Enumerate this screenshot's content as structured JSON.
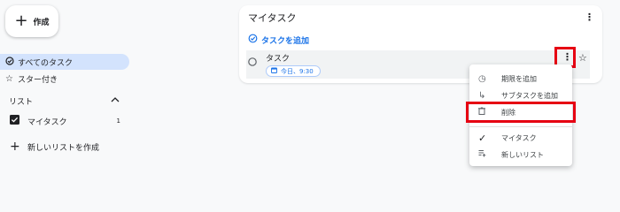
{
  "sidebar": {
    "create_label": "作成",
    "all_tasks_label": "すべてのタスク",
    "starred_label": "スター付き",
    "lists_header": "リスト",
    "list_item_label": "マイタスク",
    "list_item_count": "1",
    "new_list_label": "新しいリストを作成"
  },
  "main": {
    "list_title": "マイタスク",
    "add_task_label": "タスクを追加",
    "task_title": "タスク",
    "due_chip": "今日、9:30"
  },
  "menu": {
    "items": [
      {
        "label": "期限を追加",
        "icon": "clock-icon"
      },
      {
        "label": "サブタスクを追加",
        "icon": "subtask-icon"
      },
      {
        "label": "削除",
        "icon": "trash-icon"
      },
      {
        "label": "マイタスク",
        "icon": "check-icon"
      },
      {
        "label": "新しいリスト",
        "icon": "new-list-icon"
      }
    ]
  },
  "colors": {
    "accent": "#1a73e8",
    "active_nav": "#d3e3fd",
    "highlight": "#e60012"
  }
}
